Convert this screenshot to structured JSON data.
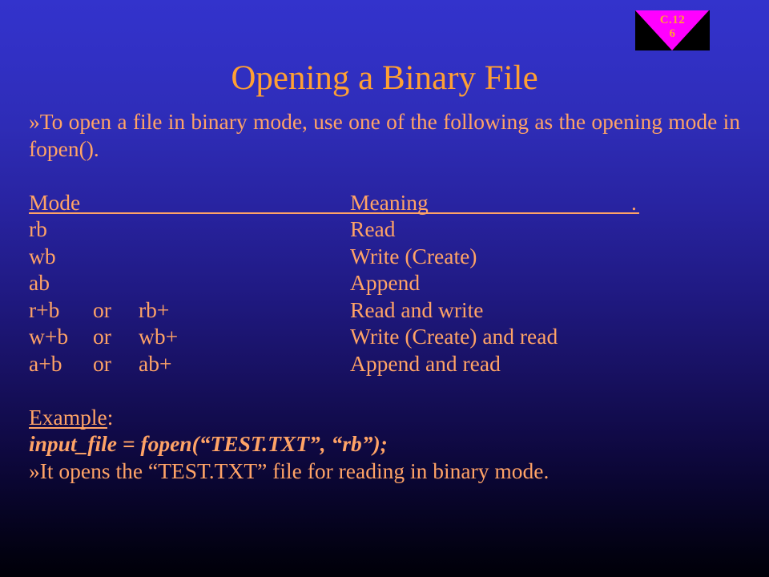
{
  "slide": {
    "title": "Opening a Binary File",
    "background_top_color": "#3333cc",
    "background_bottom_color": "#000008",
    "text_color": "#ffa366",
    "title_color": "#ffa033"
  },
  "logo": {
    "name": "chapter-badge",
    "line1": "C.12",
    "line2": "6",
    "background_color": "#000000",
    "triangle_color": "#ff00ff",
    "text_color": "#ffa033"
  },
  "intro": {
    "bullet": "»",
    "text": "To open a file in binary mode, use one of the following as the opening mode in fopen()."
  },
  "table": {
    "header": {
      "mode": "Mode",
      "meaning": "Meaning",
      "trailing_period": "."
    },
    "rows": [
      {
        "mode": "rb",
        "mode_alt": "",
        "sep": "",
        "meaning": "Read"
      },
      {
        "mode": "wb",
        "mode_alt": "",
        "sep": "",
        "meaning": "Write (Create)"
      },
      {
        "mode": "ab",
        "mode_alt": "",
        "sep": "",
        "meaning": "Append"
      },
      {
        "mode": "r+b",
        "mode_alt": "rb+",
        "sep": "or",
        "meaning": "Read and write"
      },
      {
        "mode": "w+b",
        "mode_alt": "wb+",
        "sep": "or",
        "meaning": "Write (Create) and read"
      },
      {
        "mode": "a+b",
        "mode_alt": "ab+",
        "sep": "or",
        "meaning": "Append and read"
      }
    ]
  },
  "example": {
    "label": "Example",
    "label_colon": ":",
    "code": "input_file = fopen(“TEST.TXT”, “rb”);",
    "bullet": "»",
    "note": "It opens the “TEST.TXT” file for reading in binary mode."
  }
}
